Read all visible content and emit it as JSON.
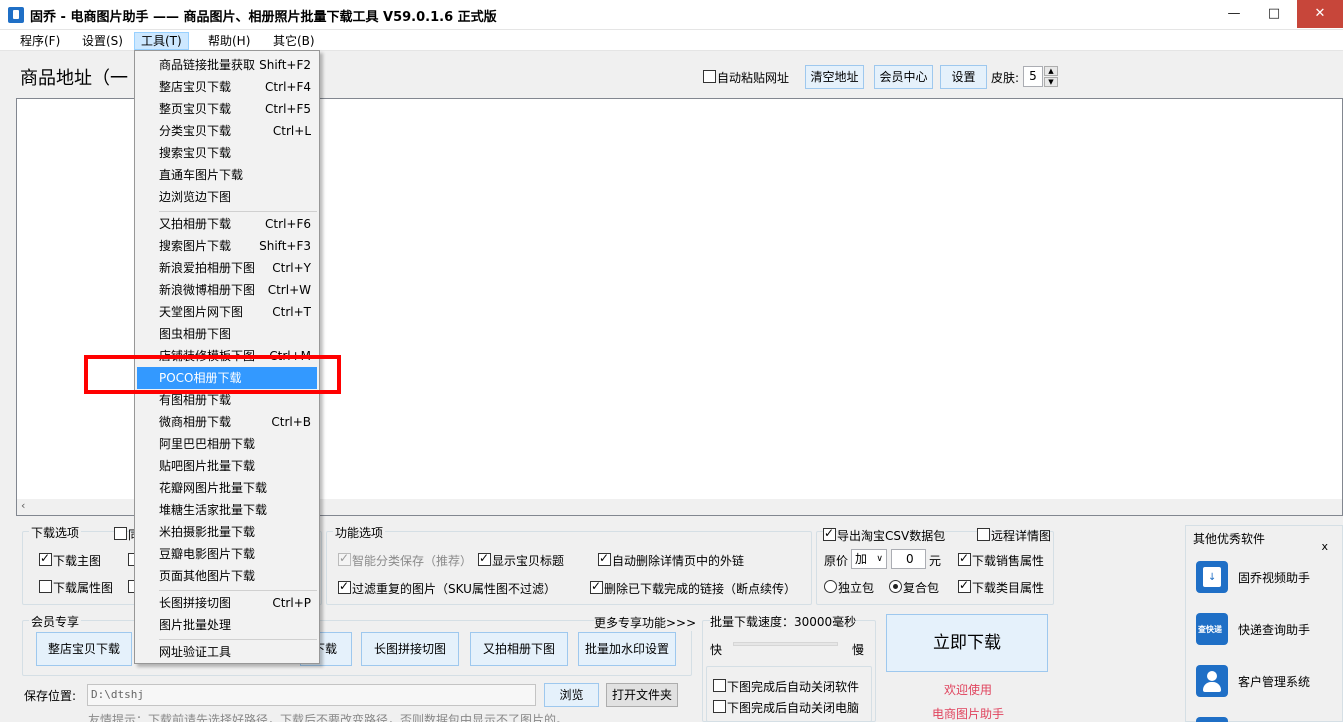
{
  "window": {
    "title": "固乔 - 电商图片助手 —— 商品图片、相册照片批量下载工具 V59.0.1.6 正式版",
    "minimize": "—",
    "maximize": "□",
    "close": "✕"
  },
  "menubar": {
    "items": [
      "程序(F)",
      "设置(S)",
      "工具(T)",
      "帮助(H)",
      "其它(B)"
    ],
    "active": "工具(T)"
  },
  "header": {
    "address_title": "商品地址（一",
    "auto_paste_label": "自动粘贴网址",
    "clear_btn": "清空地址",
    "member_btn": "会员中心",
    "settings_btn": "设置",
    "skin_label": "皮肤:",
    "skin_value": "5"
  },
  "tools_menu": {
    "items": [
      {
        "label": "商品链接批量获取",
        "key": "Shift+F2"
      },
      {
        "label": "整店宝贝下载",
        "key": "Ctrl+F4"
      },
      {
        "label": "整页宝贝下载",
        "key": "Ctrl+F5"
      },
      {
        "label": "分类宝贝下载",
        "key": "Ctrl+L"
      },
      {
        "label": "搜索宝贝下载",
        "key": ""
      },
      {
        "label": "直通车图片下载",
        "key": ""
      },
      {
        "label": "边浏览边下图",
        "key": ""
      },
      {
        "label": "又拍相册下载",
        "key": "Ctrl+F6"
      },
      {
        "label": "搜索图片下载",
        "key": "Shift+F3"
      },
      {
        "label": "新浪爱拍相册下图",
        "key": "Ctrl+Y"
      },
      {
        "label": "新浪微博相册下图",
        "key": "Ctrl+W"
      },
      {
        "label": "天堂图片网下图",
        "key": "Ctrl+T"
      },
      {
        "label": "图虫相册下图",
        "key": ""
      },
      {
        "label": "店铺装修模板下图",
        "key": "Ctrl+M"
      },
      {
        "label": "POCO相册下载",
        "key": ""
      },
      {
        "label": "有图相册下载",
        "key": ""
      },
      {
        "label": "微商相册下载",
        "key": "Ctrl+B"
      },
      {
        "label": "阿里巴巴相册下载",
        "key": ""
      },
      {
        "label": "贴吧图片批量下载",
        "key": ""
      },
      {
        "label": "花瓣网图片批量下载",
        "key": ""
      },
      {
        "label": "堆糖生活家批量下载",
        "key": ""
      },
      {
        "label": "米拍摄影批量下载",
        "key": ""
      },
      {
        "label": "豆瓣电影图片下载",
        "key": ""
      },
      {
        "label": "页面其他图片下载",
        "key": ""
      },
      {
        "label": "长图拼接切图",
        "key": "Ctrl+P"
      },
      {
        "label": "图片批量处理",
        "key": ""
      },
      {
        "label": "网址验证工具",
        "key": ""
      }
    ],
    "highlighted": "POCO相册下载"
  },
  "download_options": {
    "title": "下载选项",
    "main_image": "下载主图",
    "attr_image": "下载属性图"
  },
  "func_options": {
    "title": "功能选项",
    "smart_save": "智能分类保存（推荐）",
    "show_title": "显示宝贝标题",
    "auto_delete_links": "自动删除详情页中的外链",
    "filter_dup": "过滤重复的图片（SKU属性图不过滤）",
    "delete_done": "删除已下载完成的链接（断点续传）"
  },
  "csv_options": {
    "export_csv": "导出淘宝CSV数据包",
    "remote_detail": "远程详情图",
    "price_label": "原价",
    "price_op": "加",
    "price_value": "0",
    "price_unit": "元",
    "sales_attr": "下载销售属性",
    "single_pkg": "独立包",
    "combo_pkg": "复合包",
    "category_attr": "下载类目属性"
  },
  "member": {
    "title": "会员专享",
    "more": "更多专享功能>>>",
    "buttons": [
      "整店宝贝下载",
      "下载",
      "长图拼接切图",
      "又拍相册下图",
      "批量加水印设置"
    ]
  },
  "speed": {
    "title": "批量下载速度：30000毫秒",
    "fast": "快",
    "slow": "慢",
    "close_app": "下图完成后自动关闭软件",
    "close_pc": "下图完成后自动关闭电脑"
  },
  "download_now": "立即下载",
  "welcome": [
    "欢迎使用",
    "电商图片助手"
  ],
  "save": {
    "label": "保存位置:",
    "path": "D:\\dtshj",
    "browse": "浏览",
    "open_folder": "打开文件夹",
    "tip": "友情提示：下载前请先选择好路径，下载后不要改变路径，否则数据包中显示不了图片的。"
  },
  "other_software": {
    "title": "其他优秀软件",
    "close": "x",
    "items": [
      "固乔视频助手",
      "快递查询助手",
      "客户管理系统"
    ]
  },
  "colors": {
    "highlight": "#3399ff",
    "red_box": "#ff0000",
    "pink_text": "#e0445e",
    "icon_blue": "#1f6fc6"
  }
}
